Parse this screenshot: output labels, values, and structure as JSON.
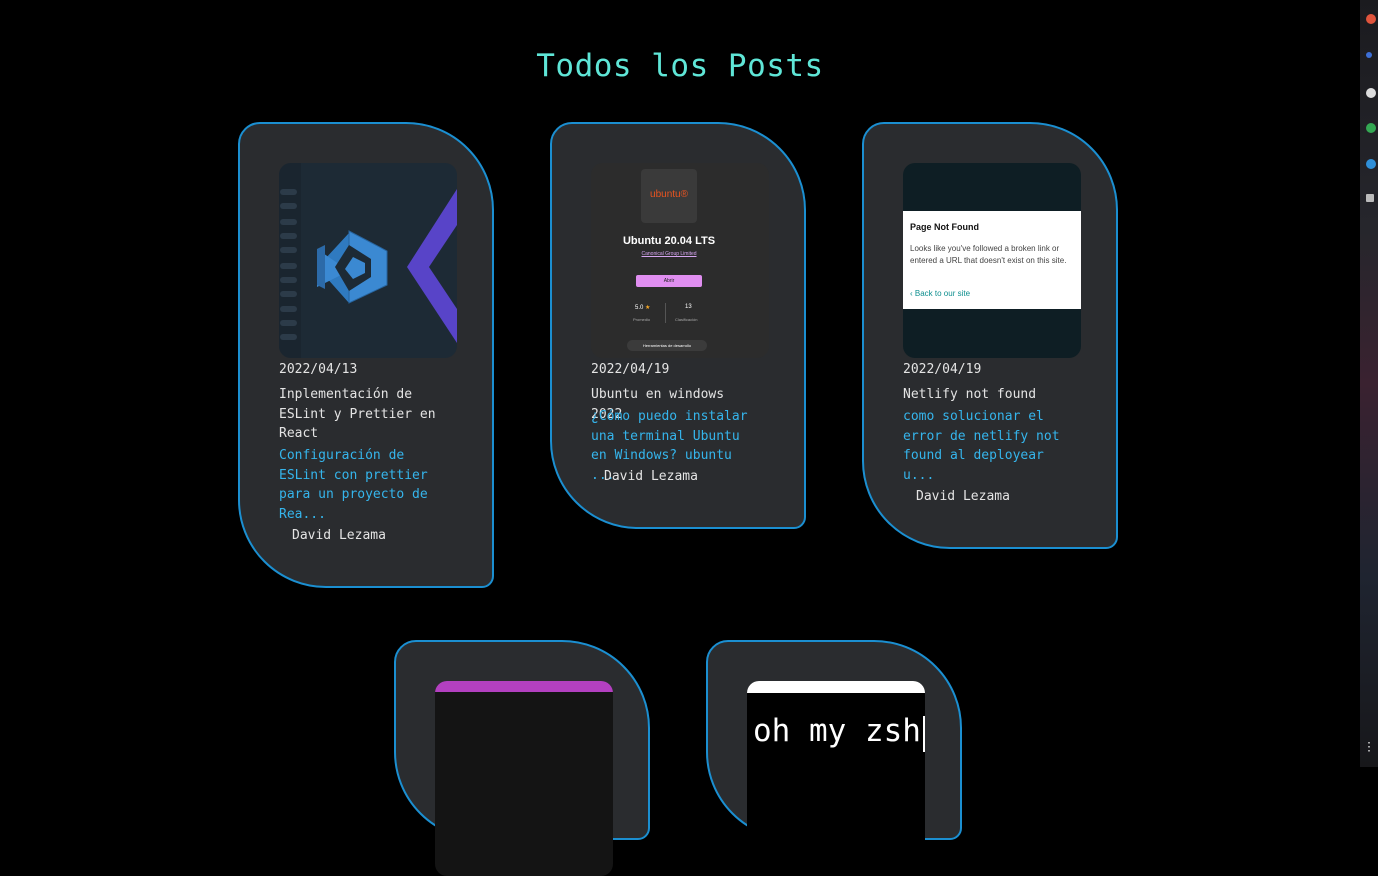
{
  "page": {
    "title": "Todos los Posts"
  },
  "posts": [
    {
      "date": "2022/04/13",
      "title": "Inplementación de ESLint y Prettier en React",
      "description": "Configuración de ESLint con prettier para un proyecto de Rea...",
      "author": "David Lezama",
      "thumbnail": "vscode-logo"
    },
    {
      "date": "2022/04/19",
      "title": "Ubuntu en windows 2022",
      "description": "¿Cómo puedo instalar una terminal Ubuntu en Windows? ubuntu ...",
      "author": "David Lezama",
      "thumbnail": {
        "logo": "ubuntu®",
        "app_name": "Ubuntu 20.04 LTS",
        "publisher": "Canonical Group Limited",
        "button": "Abrir",
        "rating": "5.0",
        "rating_label": "Promedio",
        "ratings_count": "13",
        "ratings_count_label": "Clasificación",
        "category": "Herramientas de desarrollo"
      }
    },
    {
      "date": "2022/04/19",
      "title": "Netlify not found",
      "description": "como solucionar el error de netlify not found al deployear u...",
      "author": "David Lezama",
      "thumbnail": {
        "heading": "Page Not Found",
        "body": "Looks like you've followed a broken link or entered a URL that doesn't exist on this site.",
        "link": "Back to our site"
      }
    },
    {
      "thumbnail": "purple-window"
    },
    {
      "thumbnail": {
        "text": "oh my zsh"
      }
    }
  ],
  "colors": {
    "title": "#5fe6d7",
    "card_border": "#1b8fd1",
    "card_bg": "#2a2c2f",
    "description": "#35b5ec"
  }
}
